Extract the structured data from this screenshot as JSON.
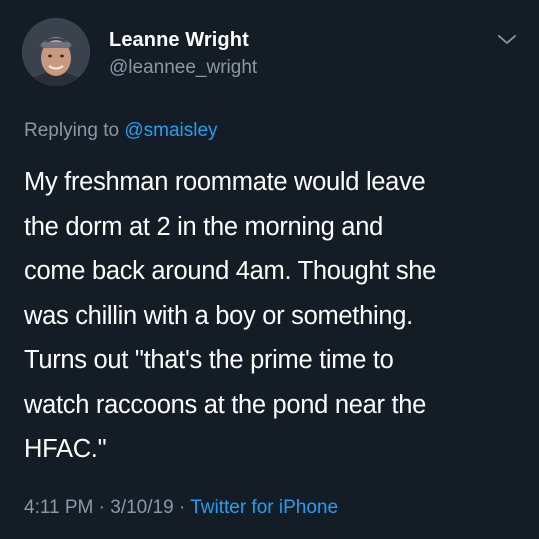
{
  "user": {
    "display_name": "Leanne Wright",
    "handle": "@leannee_wright"
  },
  "reply": {
    "prefix": "Replying to",
    "mention": "@smaisley"
  },
  "tweet": {
    "lines": [
      "My freshman roommate would leave",
      "the dorm at 2 in the morning and",
      "come back around 4am. Thought she",
      "was chillin with a boy or something.",
      "Turns out \"that's the prime time to",
      "watch raccoons at the pond near the",
      "HFAC.\""
    ]
  },
  "meta": {
    "time": "4:11 PM",
    "separator": "·",
    "date": "3/10/19",
    "source": "Twitter for iPhone"
  },
  "icons": {
    "avatar": "profile-photo",
    "menu": "chevron-down-icon"
  },
  "colors": {
    "background": "#141d26",
    "text": "#ffffff",
    "secondary": "#8899a6",
    "link": "#1da1f2"
  }
}
